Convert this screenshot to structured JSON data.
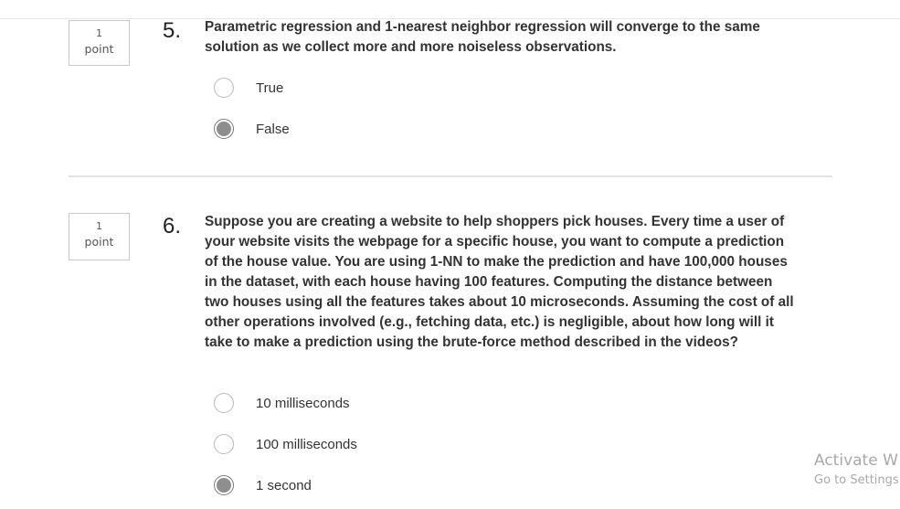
{
  "top_cut_text": "'' '' ''",
  "questions": [
    {
      "points_value": "1",
      "points_label": "point",
      "number": "5.",
      "text": "Parametric regression and 1-nearest neighbor regression will converge to the same solution as we collect more and more noiseless observations.",
      "options": [
        {
          "label": "True",
          "selected": false
        },
        {
          "label": "False",
          "selected": true
        }
      ]
    },
    {
      "points_value": "1",
      "points_label": "point",
      "number": "6.",
      "text": "Suppose you are creating a website to help shoppers pick houses. Every time a user of your website visits the webpage for a specific house, you want to compute a prediction of the house value. You are using 1-NN to make the prediction and have 100,000 houses in the dataset, with each house having 100 features. Computing the distance between two houses using all the features takes about 10 microseconds. Assuming the cost of all other operations involved (e.g., fetching data, etc.) is negligible, about how long will it take to make a prediction using the brute-force method described in the videos?",
      "options": [
        {
          "label": "10 milliseconds",
          "selected": false
        },
        {
          "label": "100 milliseconds",
          "selected": false
        },
        {
          "label": "1 second",
          "selected": true
        }
      ]
    }
  ],
  "watermark": {
    "title": "Activate W",
    "subtitle": "Go to Settings"
  }
}
